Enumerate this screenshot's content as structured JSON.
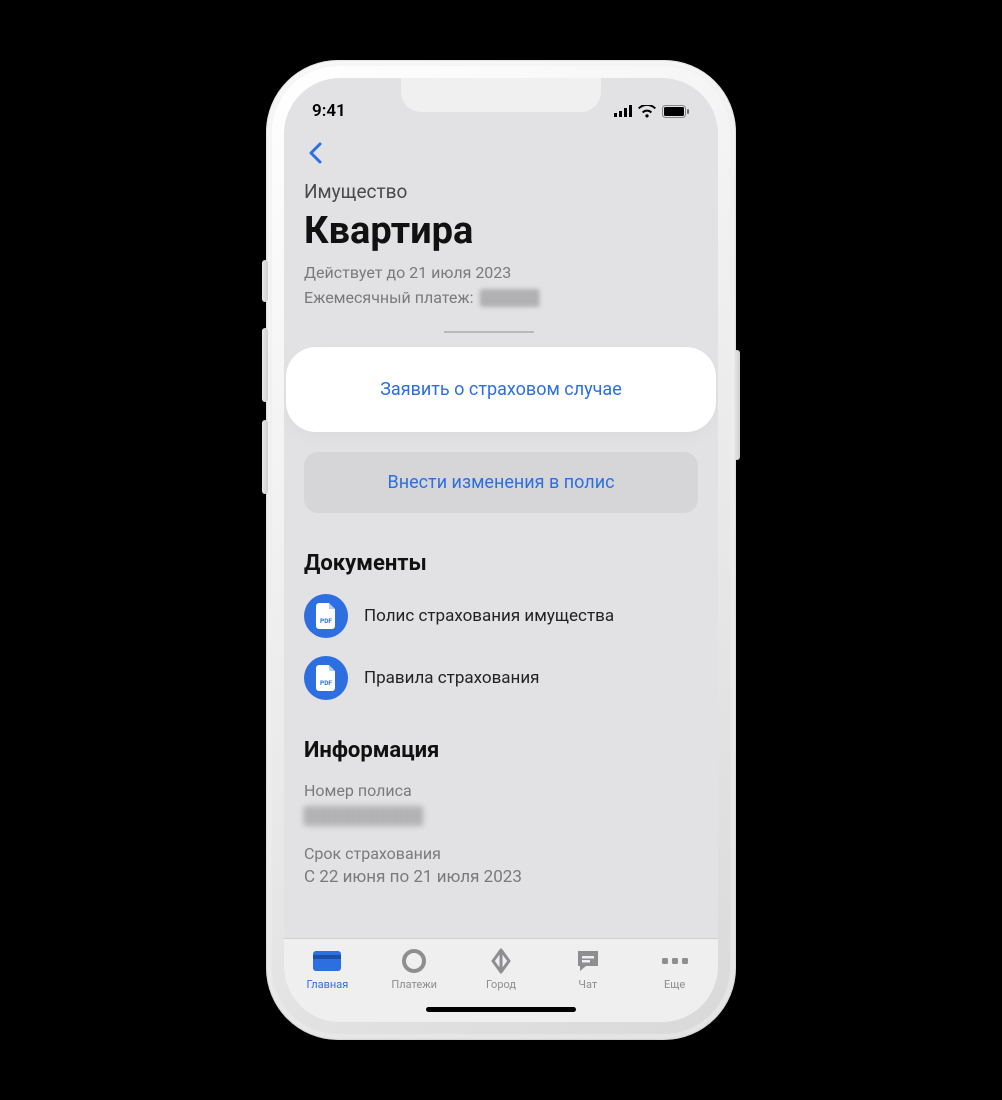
{
  "status": {
    "time": "9:41"
  },
  "header": {
    "category": "Имущество",
    "title": "Квартира",
    "valid_until": "Действует до 21 июля 2023",
    "monthly_payment_label": "Ежемесячный платеж:"
  },
  "actions": {
    "report_claim": "Заявить о страховом случае",
    "amend_policy": "Внести изменения в полис"
  },
  "documents": {
    "title": "Документы",
    "items": [
      {
        "label": "Полис страхования имущества"
      },
      {
        "label": "Правила страхования"
      }
    ]
  },
  "info": {
    "title": "Информация",
    "policy_number_label": "Номер полиса",
    "term_label": "Срок страхования",
    "term_value": "С 22 июня по 21 июля 2023"
  },
  "tabbar": {
    "home": "Главная",
    "payments": "Платежи",
    "city": "Город",
    "chat": "Чат",
    "more": "Еще"
  }
}
